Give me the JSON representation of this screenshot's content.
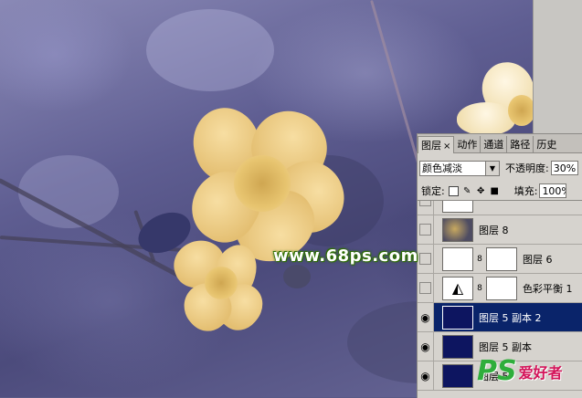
{
  "panel": {
    "tabs": [
      {
        "label": "图层",
        "close": "×",
        "active": true
      },
      {
        "label": "动作"
      },
      {
        "label": "通道"
      },
      {
        "label": "路径"
      },
      {
        "label": "历史"
      }
    ],
    "blend_mode": "颜色减淡",
    "opacity_label": "不透明度:",
    "opacity_value": "30%",
    "lock_label": "锁定:",
    "fill_label": "填充:",
    "fill_value": "100%",
    "layers": [
      {
        "name": "图层 8",
        "visible": false,
        "thumb": "photo"
      },
      {
        "name": "图层 6",
        "visible": false,
        "thumb": "white"
      },
      {
        "name": "色彩平衡 1",
        "visible": false,
        "thumb": "adjustment"
      },
      {
        "name": "图层 5 副本 2",
        "visible": true,
        "thumb": "navy",
        "selected": true
      },
      {
        "name": "图层 5 副本",
        "visible": true,
        "thumb": "navy"
      },
      {
        "name": "图层 5",
        "visible": true,
        "thumb": "navy"
      }
    ]
  },
  "watermark": {
    "site": "www.68ps.com",
    "logo": "PS",
    "logo_text": "爱好者"
  },
  "colors": {
    "selection": "#0a246a",
    "panel_bg": "#d6d3ce",
    "petal": "#f2d594"
  }
}
